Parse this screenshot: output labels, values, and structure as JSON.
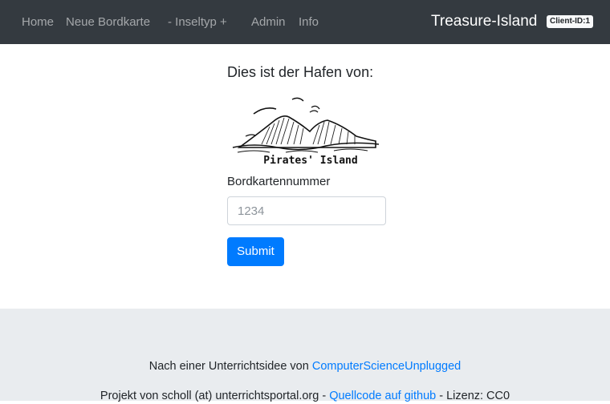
{
  "navbar": {
    "links": [
      "Home",
      "Neue Bordkarte",
      "- Inseltyp +",
      "Admin",
      "Info"
    ],
    "brand": "Treasure-Island",
    "client_badge": "Client-ID:1"
  },
  "main": {
    "heading": "Dies ist der Hafen von:",
    "island_name": "Pirates' Island",
    "form": {
      "label": "Bordkartennummer",
      "input_placeholder": "1234",
      "input_value": "",
      "submit_label": "Submit"
    }
  },
  "footer": {
    "line1_prefix": "Nach einer Unterrichtsidee von ",
    "line1_link": "ComputerScienceUnplugged",
    "line2_prefix": "Projekt von scholl (at) unterrichtsportal.org - ",
    "line2_link": "Quellcode auf github",
    "line2_suffix": " - Lizenz: CC0"
  },
  "colors": {
    "navbar_bg": "#343a40",
    "primary": "#007bff",
    "footer_bg": "#e9ecef"
  },
  "icons": {
    "island": "island-illustration"
  }
}
